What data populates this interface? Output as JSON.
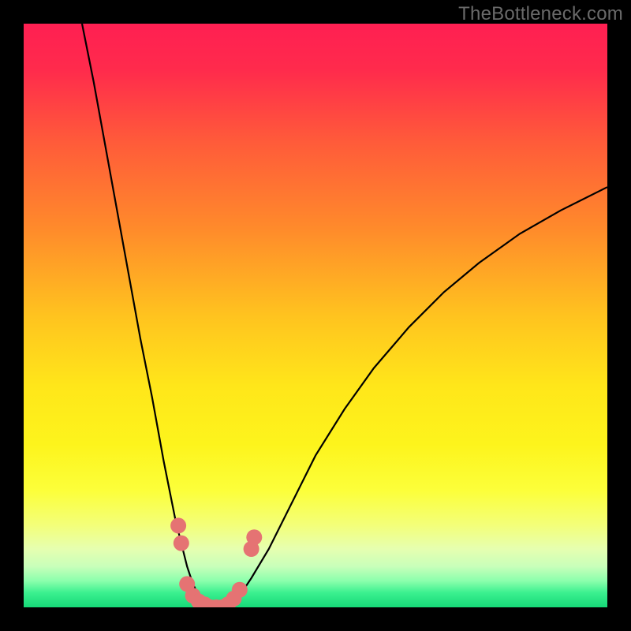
{
  "watermark": "TheBottleneck.com",
  "chart_data": {
    "type": "line",
    "title": "",
    "xlabel": "",
    "ylabel": "",
    "xlim": [
      0,
      100
    ],
    "ylim": [
      0,
      100
    ],
    "grid": false,
    "legend": false,
    "series": [
      {
        "name": "left-curve",
        "x": [
          10,
          12,
          14,
          16,
          18,
          20,
          22,
          24,
          25,
          26,
          27,
          28,
          29,
          30,
          31,
          32
        ],
        "values": [
          100,
          90,
          79,
          68,
          57,
          46,
          36,
          25,
          20,
          15,
          11,
          7,
          4,
          2,
          0.8,
          0
        ]
      },
      {
        "name": "right-curve",
        "x": [
          35,
          37,
          39,
          42,
          46,
          50,
          55,
          60,
          66,
          72,
          78,
          85,
          92,
          100
        ],
        "values": [
          0,
          2,
          5,
          10,
          18,
          26,
          34,
          41,
          48,
          54,
          59,
          64,
          68,
          72
        ]
      }
    ],
    "markers": {
      "name": "highlight-dots",
      "color": "#e57373",
      "radius_px": 10,
      "points": [
        {
          "x": 26.5,
          "y": 14
        },
        {
          "x": 27.0,
          "y": 11
        },
        {
          "x": 28.0,
          "y": 4
        },
        {
          "x": 29.0,
          "y": 2
        },
        {
          "x": 30.0,
          "y": 1
        },
        {
          "x": 31.0,
          "y": 0.5
        },
        {
          "x": 32.0,
          "y": 0
        },
        {
          "x": 33.0,
          "y": 0
        },
        {
          "x": 34.0,
          "y": 0
        },
        {
          "x": 35.0,
          "y": 0.5
        },
        {
          "x": 36.0,
          "y": 1.5
        },
        {
          "x": 37.0,
          "y": 3
        },
        {
          "x": 39.0,
          "y": 10
        },
        {
          "x": 39.5,
          "y": 12
        }
      ]
    },
    "background_gradient": {
      "type": "vertical",
      "stops": [
        {
          "offset": 0.0,
          "color": "#ff1f52"
        },
        {
          "offset": 0.08,
          "color": "#ff2b4c"
        },
        {
          "offset": 0.2,
          "color": "#ff5a3a"
        },
        {
          "offset": 0.35,
          "color": "#ff8a2b"
        },
        {
          "offset": 0.5,
          "color": "#ffc31f"
        },
        {
          "offset": 0.62,
          "color": "#ffe61a"
        },
        {
          "offset": 0.72,
          "color": "#fdf41c"
        },
        {
          "offset": 0.8,
          "color": "#fcff3a"
        },
        {
          "offset": 0.86,
          "color": "#f3ff7a"
        },
        {
          "offset": 0.9,
          "color": "#e6ffb0"
        },
        {
          "offset": 0.93,
          "color": "#c8ffba"
        },
        {
          "offset": 0.955,
          "color": "#8affac"
        },
        {
          "offset": 0.975,
          "color": "#3bf08f"
        },
        {
          "offset": 1.0,
          "color": "#16d978"
        }
      ]
    }
  }
}
